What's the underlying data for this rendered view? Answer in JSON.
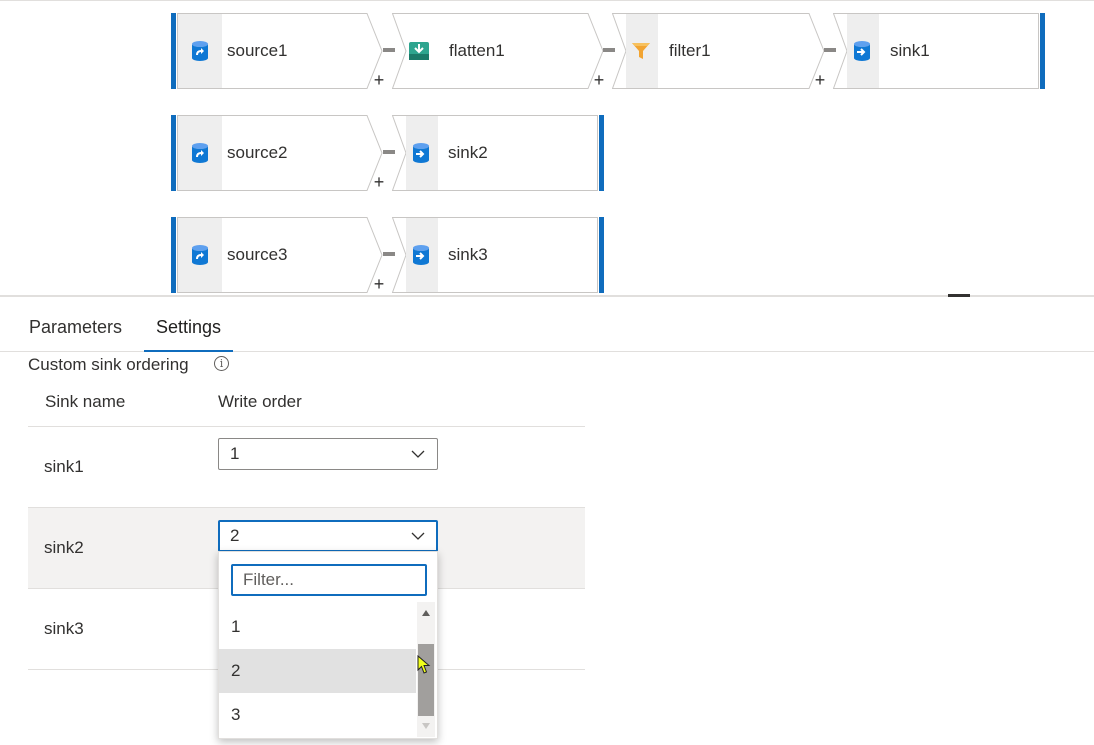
{
  "pipeline": {
    "rows": [
      {
        "nodes": [
          {
            "label": "source1",
            "icon": "source-icon"
          },
          {
            "label": "flatten1",
            "icon": "flatten-icon"
          },
          {
            "label": "filter1",
            "icon": "filter-icon"
          },
          {
            "label": "sink1",
            "icon": "sink-icon"
          }
        ]
      },
      {
        "nodes": [
          {
            "label": "source2",
            "icon": "source-icon"
          },
          {
            "label": "sink2",
            "icon": "sink-icon"
          }
        ]
      },
      {
        "nodes": [
          {
            "label": "source3",
            "icon": "source-icon"
          },
          {
            "label": "sink3",
            "icon": "sink-icon"
          }
        ]
      }
    ],
    "plus_symbol": "+"
  },
  "tabs": [
    {
      "label": "Parameters",
      "active": false
    },
    {
      "label": "Settings",
      "active": true
    }
  ],
  "settings": {
    "section_title": "Custom sink ordering",
    "info_glyph": "i",
    "columns": {
      "sink_name": "Sink name",
      "write_order": "Write order"
    },
    "rows": [
      {
        "sink": "sink1",
        "order": "1"
      },
      {
        "sink": "sink2",
        "order": "2"
      },
      {
        "sink": "sink3",
        "order": ""
      }
    ],
    "dropdown": {
      "filter_placeholder": "Filter...",
      "options": [
        "1",
        "2",
        "3"
      ],
      "highlighted": "2"
    }
  },
  "colors": {
    "accent": "#0f6cbd",
    "filter_icon": "#f2a431",
    "flatten_icon": "#2ea58f",
    "db_icon": "#0f78d4"
  }
}
